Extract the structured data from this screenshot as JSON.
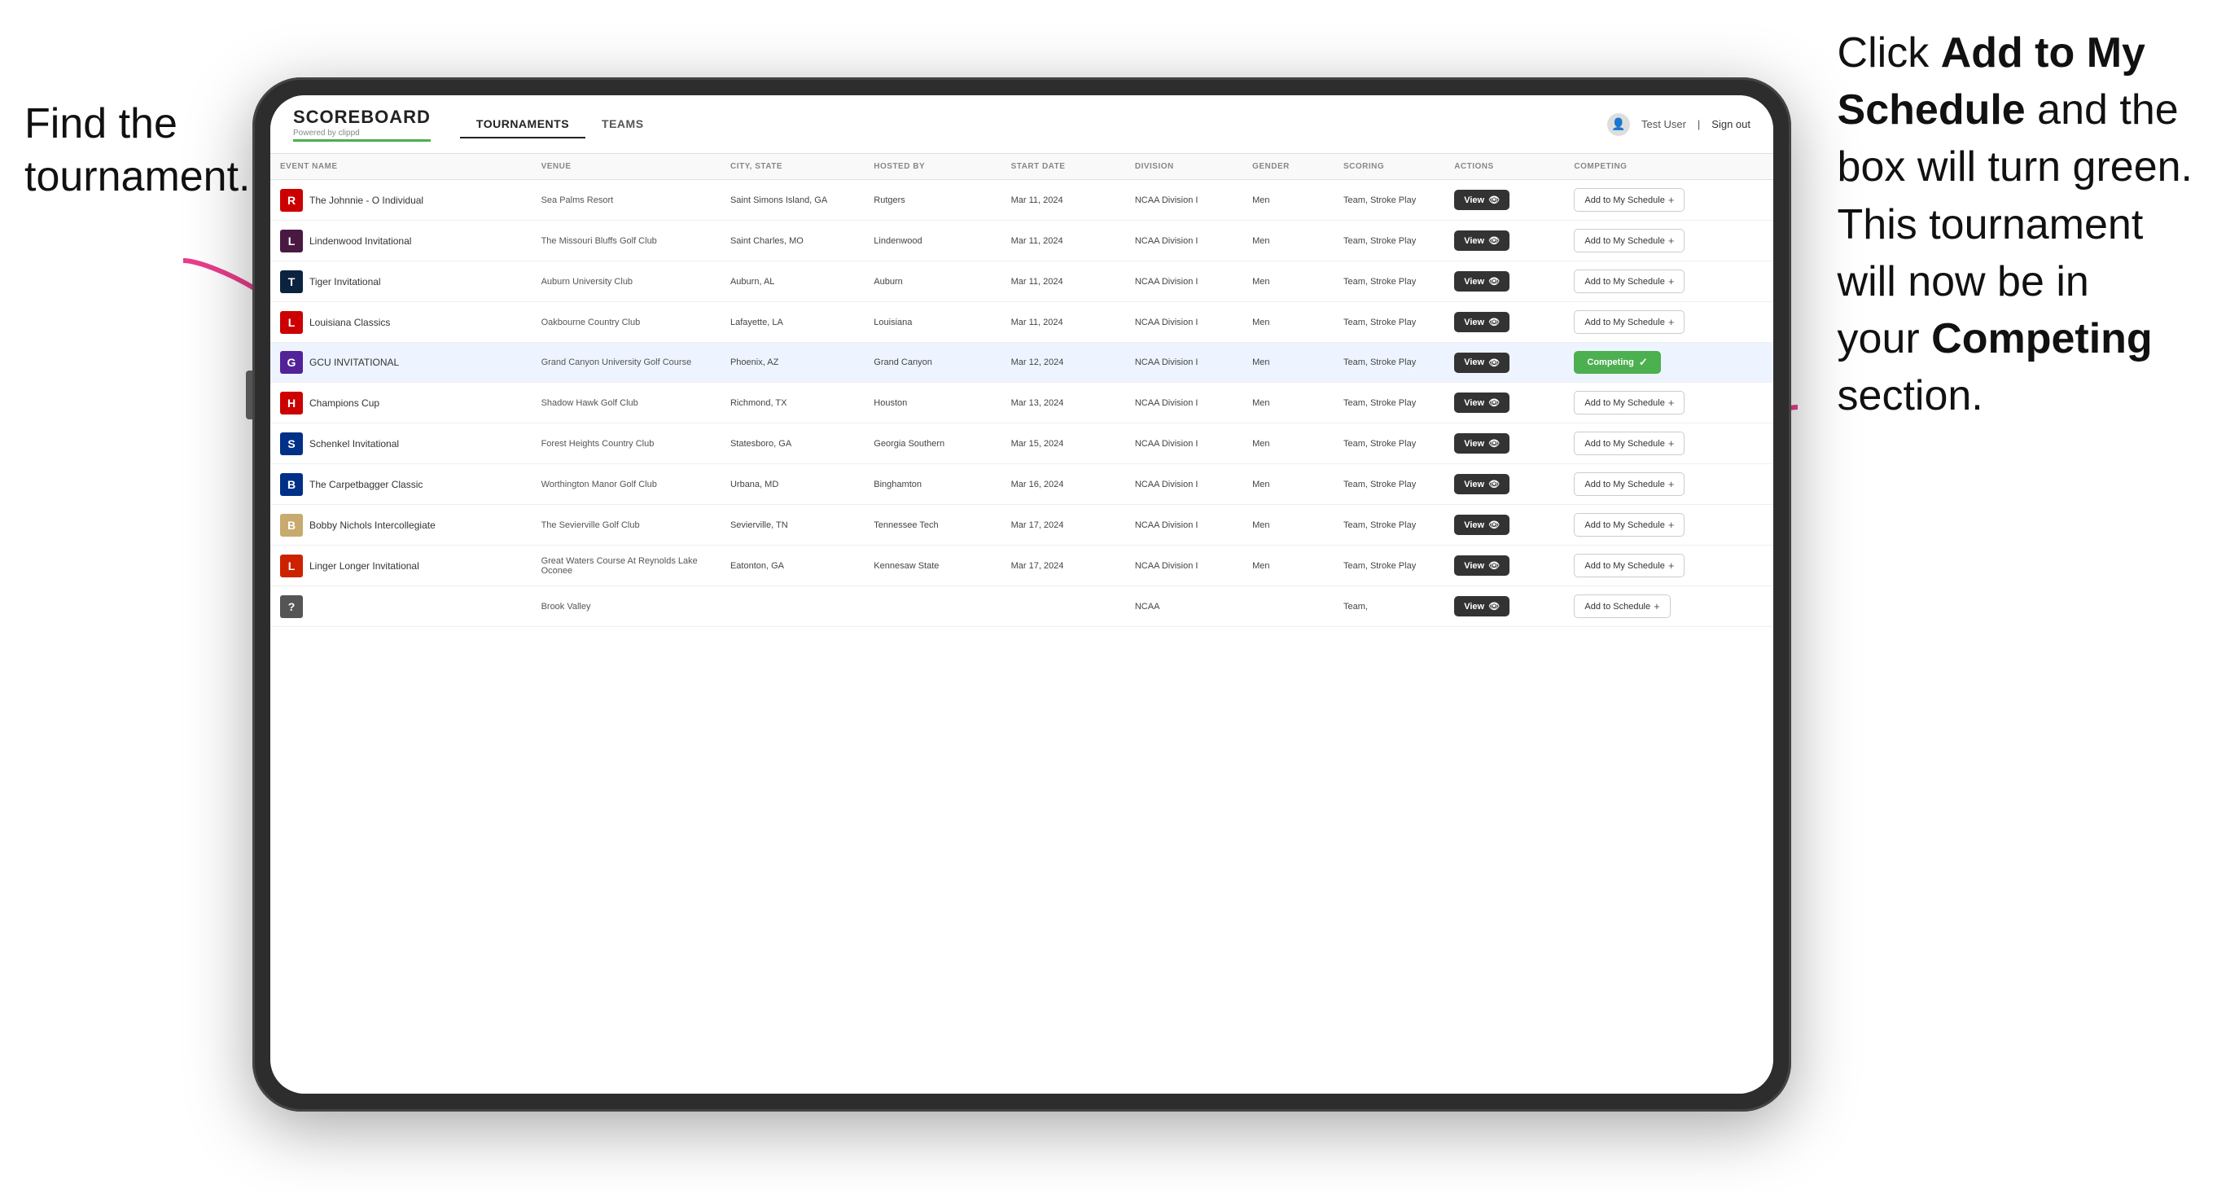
{
  "annotations": {
    "left": "Find the\ntournament.",
    "right_before_bold1": "Click ",
    "right_bold1": "Add to My Schedule",
    "right_after_bold1": " and the box will turn green. This tournament will now be in your ",
    "right_bold2": "Competing",
    "right_after_bold2": " section."
  },
  "header": {
    "logo": "SCOREBOARD",
    "logo_sub": "Powered by clippd",
    "nav": [
      "TOURNAMENTS",
      "TEAMS"
    ],
    "active_nav": "TOURNAMENTS",
    "user": "Test User",
    "signout": "Sign out"
  },
  "table": {
    "columns": [
      "EVENT NAME",
      "VENUE",
      "CITY, STATE",
      "HOSTED BY",
      "START DATE",
      "DIVISION",
      "GENDER",
      "SCORING",
      "ACTIONS",
      "COMPETING"
    ],
    "rows": [
      {
        "logo_color": "#cc0000",
        "logo_letter": "R",
        "event": "The Johnnie - O Individual",
        "venue": "Sea Palms Resort",
        "city": "Saint Simons Island, GA",
        "hosted": "Rutgers",
        "date": "Mar 11, 2024",
        "division": "NCAA Division I",
        "gender": "Men",
        "scoring": "Team, Stroke Play",
        "action": "View",
        "competing": "Add to My Schedule",
        "competing_type": "add",
        "highlighted": false
      },
      {
        "logo_color": "#4a1942",
        "logo_letter": "L",
        "event": "Lindenwood Invitational",
        "venue": "The Missouri Bluffs Golf Club",
        "city": "Saint Charles, MO",
        "hosted": "Lindenwood",
        "date": "Mar 11, 2024",
        "division": "NCAA Division I",
        "gender": "Men",
        "scoring": "Team, Stroke Play",
        "action": "View",
        "competing": "Add to My Schedule",
        "competing_type": "add",
        "highlighted": false
      },
      {
        "logo_color": "#0c2340",
        "logo_letter": "T",
        "event": "Tiger Invitational",
        "venue": "Auburn University Club",
        "city": "Auburn, AL",
        "hosted": "Auburn",
        "date": "Mar 11, 2024",
        "division": "NCAA Division I",
        "gender": "Men",
        "scoring": "Team, Stroke Play",
        "action": "View",
        "competing": "Add to My Schedule",
        "competing_type": "add",
        "highlighted": false
      },
      {
        "logo_color": "#cc0000",
        "logo_letter": "L",
        "event": "Louisiana Classics",
        "venue": "Oakbourne Country Club",
        "city": "Lafayette, LA",
        "hosted": "Louisiana",
        "date": "Mar 11, 2024",
        "division": "NCAA Division I",
        "gender": "Men",
        "scoring": "Team, Stroke Play",
        "action": "View",
        "competing": "Add to My Schedule",
        "competing_type": "add",
        "highlighted": false
      },
      {
        "logo_color": "#522398",
        "logo_letter": "G",
        "event": "GCU INVITATIONAL",
        "venue": "Grand Canyon University Golf Course",
        "city": "Phoenix, AZ",
        "hosted": "Grand Canyon",
        "date": "Mar 12, 2024",
        "division": "NCAA Division I",
        "gender": "Men",
        "scoring": "Team, Stroke Play",
        "action": "View",
        "competing": "Competing",
        "competing_type": "competing",
        "highlighted": true
      },
      {
        "logo_color": "#cc0000",
        "logo_letter": "H",
        "event": "Champions Cup",
        "venue": "Shadow Hawk Golf Club",
        "city": "Richmond, TX",
        "hosted": "Houston",
        "date": "Mar 13, 2024",
        "division": "NCAA Division I",
        "gender": "Men",
        "scoring": "Team, Stroke Play",
        "action": "View",
        "competing": "Add to My Schedule",
        "competing_type": "add",
        "highlighted": false
      },
      {
        "logo_color": "#003087",
        "logo_letter": "S",
        "event": "Schenkel Invitational",
        "venue": "Forest Heights Country Club",
        "city": "Statesboro, GA",
        "hosted": "Georgia Southern",
        "date": "Mar 15, 2024",
        "division": "NCAA Division I",
        "gender": "Men",
        "scoring": "Team, Stroke Play",
        "action": "View",
        "competing": "Add to My Schedule",
        "competing_type": "add",
        "highlighted": false
      },
      {
        "logo_color": "#003087",
        "logo_letter": "B",
        "event": "The Carpetbagger Classic",
        "venue": "Worthington Manor Golf Club",
        "city": "Urbana, MD",
        "hosted": "Binghamton",
        "date": "Mar 16, 2024",
        "division": "NCAA Division I",
        "gender": "Men",
        "scoring": "Team, Stroke Play",
        "action": "View",
        "competing": "Add to My Schedule",
        "competing_type": "add",
        "highlighted": false
      },
      {
        "logo_color": "#c8a96e",
        "logo_letter": "B",
        "event": "Bobby Nichols Intercollegiate",
        "venue": "The Sevierville Golf Club",
        "city": "Sevierville, TN",
        "hosted": "Tennessee Tech",
        "date": "Mar 17, 2024",
        "division": "NCAA Division I",
        "gender": "Men",
        "scoring": "Team, Stroke Play",
        "action": "View",
        "competing": "Add to My Schedule",
        "competing_type": "add",
        "highlighted": false
      },
      {
        "logo_color": "#cc2200",
        "logo_letter": "L",
        "event": "Linger Longer Invitational",
        "venue": "Great Waters Course At Reynolds Lake Oconee",
        "city": "Eatonton, GA",
        "hosted": "Kennesaw State",
        "date": "Mar 17, 2024",
        "division": "NCAA Division I",
        "gender": "Men",
        "scoring": "Team, Stroke Play",
        "action": "View",
        "competing": "Add to My Schedule",
        "competing_type": "add",
        "highlighted": false
      },
      {
        "logo_color": "#555",
        "logo_letter": "?",
        "event": "",
        "venue": "Brook Valley",
        "city": "",
        "hosted": "",
        "date": "",
        "division": "NCAA",
        "gender": "",
        "scoring": "Team,",
        "action": "View",
        "competing": "Add to Schedule",
        "competing_type": "add",
        "highlighted": false
      }
    ]
  }
}
